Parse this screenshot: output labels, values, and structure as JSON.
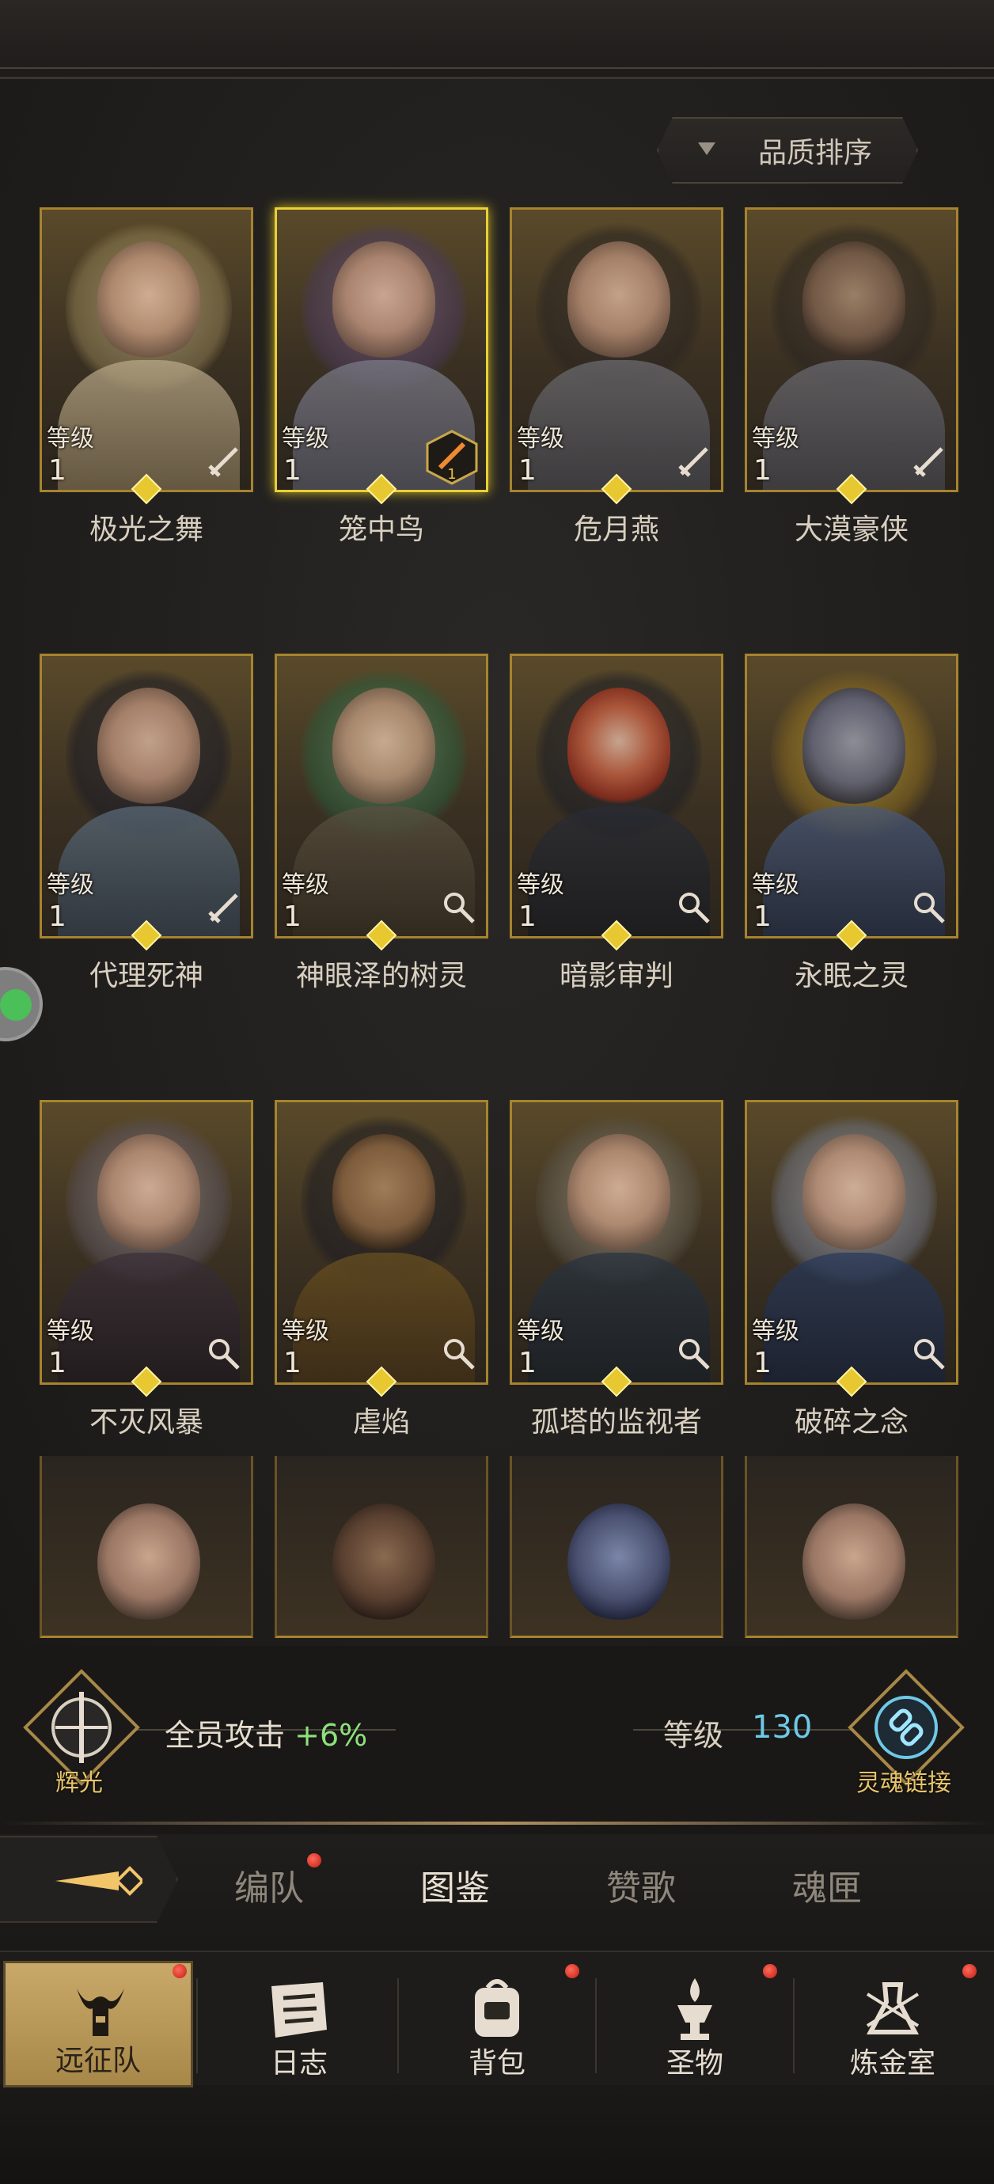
{
  "sort": {
    "label": "品质排序"
  },
  "level_label": "等级",
  "heroes": [
    {
      "name": "极光之舞",
      "level": "1",
      "class_icon": "sword-icon"
    },
    {
      "name": "笼中鸟",
      "level": "1",
      "class_icon": "badge-icon"
    },
    {
      "name": "危月燕",
      "level": "1",
      "class_icon": "sword-icon"
    },
    {
      "name": "大漠豪侠",
      "level": "1",
      "class_icon": "sword-icon"
    },
    {
      "name": "代理死神",
      "level": "1",
      "class_icon": "sword-icon"
    },
    {
      "name": "神眼泽的树灵",
      "level": "1",
      "class_icon": "staff-icon"
    },
    {
      "name": "暗影审判",
      "level": "1",
      "class_icon": "staff-icon"
    },
    {
      "name": "永眠之灵",
      "level": "1",
      "class_icon": "staff-icon"
    },
    {
      "name": "不灭风暴",
      "level": "1",
      "class_icon": "staff-icon"
    },
    {
      "name": "虐焰",
      "level": "1",
      "class_icon": "staff-icon"
    },
    {
      "name": "孤塔的监视者",
      "level": "1",
      "class_icon": "staff-icon"
    },
    {
      "name": "破碎之念",
      "level": "1",
      "class_icon": "staff-icon"
    }
  ],
  "badge_value": "1",
  "buff": {
    "emblem_label": "辉光",
    "text": "全员攻击",
    "value": "+6%",
    "level_label": "等级",
    "level_value": "130",
    "link_label": "灵魂链接"
  },
  "tabs": [
    {
      "label": "编队",
      "dot": true
    },
    {
      "label": "图鉴",
      "active": true
    },
    {
      "label": "赞歌"
    },
    {
      "label": "魂匣"
    }
  ],
  "nav": [
    {
      "label": "远征队",
      "active": true
    },
    {
      "label": "日志"
    },
    {
      "label": "背包"
    },
    {
      "label": "圣物"
    },
    {
      "label": "炼金室"
    }
  ]
}
